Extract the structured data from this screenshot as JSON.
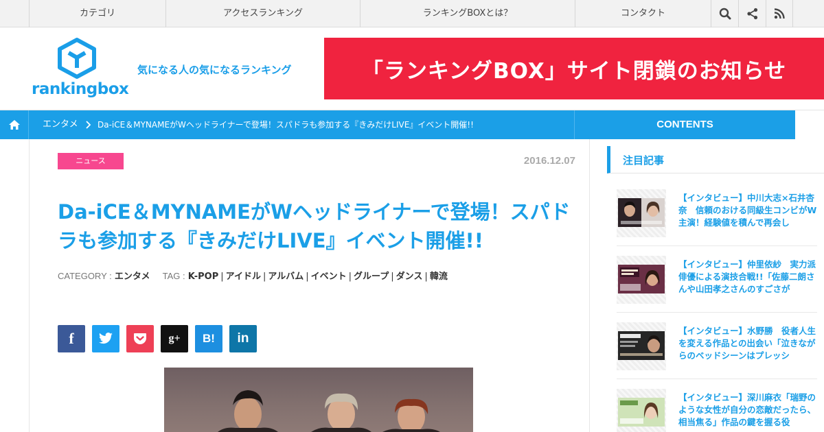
{
  "topnav": {
    "items": [
      "カテゴリ",
      "アクセスランキング",
      "ランキングBOXとは？",
      "コンタクト"
    ],
    "icons": [
      "search-icon",
      "share-icon",
      "rss-icon"
    ]
  },
  "header": {
    "logo_text": "rankingbox",
    "tagline": "気になる人の気になるランキング",
    "banner": "「ランキングBOX」サイト閉鎖のお知らせ"
  },
  "breadcrumb": {
    "home_icon": "home-icon",
    "category": "エンタメ",
    "current": "Da-iCE＆MYNAMEがWヘッドライナーで登場！スパドラも参加する『きみだけLIVE』イベント開催!!",
    "contents_tab": "CONTENTS"
  },
  "article": {
    "badge": "ニュース",
    "date": "2016.12.07",
    "title": "Da-iCE＆MYNAMEがWヘッドライナーで登場！スパドラも参加する『きみだけLIVE』イベント開催!!",
    "category_label": "CATEGORY :",
    "category": "エンタメ",
    "tag_label": "TAG :",
    "tags": [
      "K-POP",
      "アイドル",
      "アルバム",
      "イベント",
      "グループ",
      "ダンス",
      "韓流"
    ],
    "share_buttons": [
      {
        "icon": "facebook-icon",
        "label": "f",
        "color": "#3b5998"
      },
      {
        "icon": "twitter-icon",
        "label": "",
        "color": "#1da1f2"
      },
      {
        "icon": "pocket-icon",
        "label": "",
        "color": "#ee4056"
      },
      {
        "icon": "googleplus-icon",
        "label": "g+",
        "color": "#111111"
      },
      {
        "icon": "hatena-icon",
        "label": "B!",
        "color": "#1d8fe0"
      },
      {
        "icon": "linkedin-icon",
        "label": "in",
        "color": "#0e76a8"
      }
    ]
  },
  "sidebar": {
    "heading": "注目記事",
    "items": [
      {
        "text": "【インタビュー】中川大志×石井杏奈　信頼のおける同級生コンビがW主演！経験値を積んで再会し"
      },
      {
        "text": "【インタビュー】仲里依紗　実力派俳優による演技合戦!!「佐藤二朗さんや山田孝之さんのすごさが"
      },
      {
        "text": "【インタビュー】水野勝　役者人生を変える作品との出会い「泣きながらのベッドシーンはプレッシ"
      },
      {
        "text": "【インタビュー】深川麻衣「瑞野のような女性が自分の恋敵だったら、相当焦る」作品の鍵を握る役"
      }
    ]
  },
  "colors": {
    "brand_blue": "#1b9fe7",
    "banner_red": "#f0233f",
    "badge_pink": "#f7478f"
  }
}
